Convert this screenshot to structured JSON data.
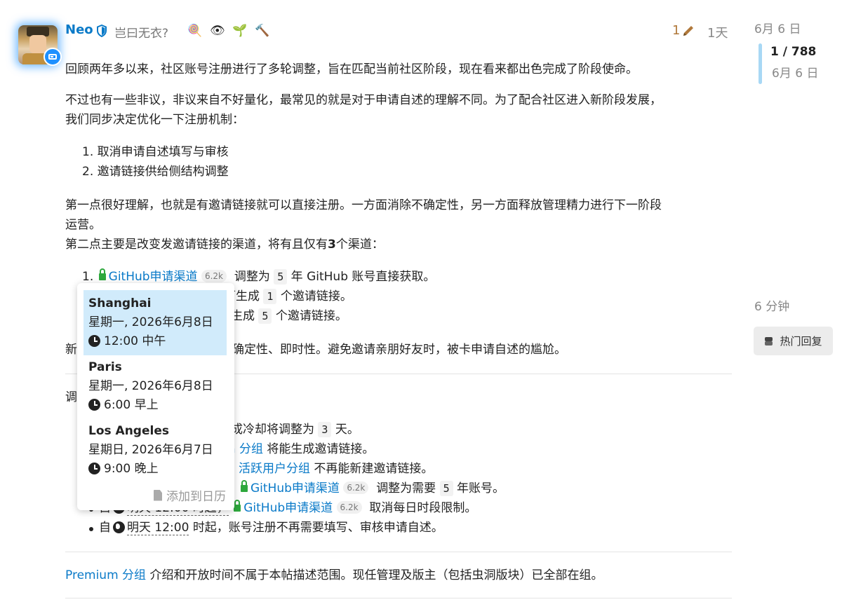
{
  "post": {
    "username": "Neo",
    "user_title": "岂曰无衣?",
    "badges": [
      "🍭",
      "👁",
      "🌱",
      "🔨"
    ],
    "edit_count": "1",
    "age": "1天",
    "colors": {
      "link": "#0a7ac8",
      "edit": "#b0783a",
      "lock": "#2ea83d",
      "active_tz": "#d1ebfb"
    }
  },
  "body": {
    "p1": "回顾两年多以来，社区账号注册进行了多轮调整，旨在匹配当前社区阶段，现在看来都出色完成了阶段使命。",
    "p2_line1": "不过也有一些非议，非议来自不好量化，最常见的就是对于申请自述的理解不同。为了配合社区进入新阶段发展，",
    "p2_line2": "我们同步决定优化一下注册机制：",
    "list1_1": "1. 取消申请自述填写与审核",
    "list1_2": "2. 邀请链接供给侧结构调整",
    "p3_line1": "第一点很好理解，也就是有邀请链接就可以直接注册。一方面消除不确定性，另一方面释放管理精力进行下一阶段",
    "p3_line2": "运营。",
    "p4_pre": "第二点主要是改变发邀请链接的渠道，将有且仅有",
    "p4_bold": "3",
    "p4_post": "个渠道：",
    "item1_num": "1.",
    "github_link": "GitHub申请渠道",
    "github_count": "6.2k",
    "item1_a": "调整为",
    "item1_code": "5",
    "item1_b": "年 GitHub 账号直接获取。",
    "item2_a": "可生成",
    "item2_code": "1",
    "item2_b": "个邀请链接。",
    "item3_a": "生成",
    "item3_code": "5",
    "item3_b": "个邀请链接。",
    "p5_pre": "新",
    "p5_post": "确定性、即时性。避免邀请亲朋好友时，被卡申请自述的尴尬。",
    "p6_pre": "调",
    "b1_a": "成冷却将调整为",
    "b1_code": "3",
    "b1_b": "天。",
    "b2_link": "m 分组",
    "b2_b": "将能生成邀请链接。",
    "b3_link": "活跃用户分组",
    "b3_b": "不再能新建邀请链接。",
    "b4_a": "调整为需要",
    "b4_code": "5",
    "b4_b": "年账号。",
    "b5_pre": "自",
    "b5_time": "明天 12:00 时起，",
    "b5_b": "取消每日时段限制。",
    "b6_pre": "自",
    "b6_time": "明天 12:00",
    "b6_b": "时起，账号注册不再需要填写、审核申请自述。",
    "p7_link": "Premium 分组",
    "p7_b": "介绍和开放时间不属于本帖描述范围。现任管理及版主（包括虫洞版块）已全部在组。"
  },
  "popup": {
    "zones": [
      {
        "city": "Shanghai",
        "date": "星期一, 2026年6月8日",
        "time": "12:00 中午"
      },
      {
        "city": "Paris",
        "date": "星期一, 2026年6月8日",
        "time": "6:00 早上"
      },
      {
        "city": "Los Angeles",
        "date": "星期日, 2026年6月7日",
        "time": "9:00 晚上"
      }
    ],
    "add_calendar": "添加到日历"
  },
  "timeline": {
    "start_date": "6月 6 日",
    "position": "1 / 788",
    "position_date": "6月 6 日",
    "end_label": "6 分钟",
    "hot_button": "热门回复"
  }
}
